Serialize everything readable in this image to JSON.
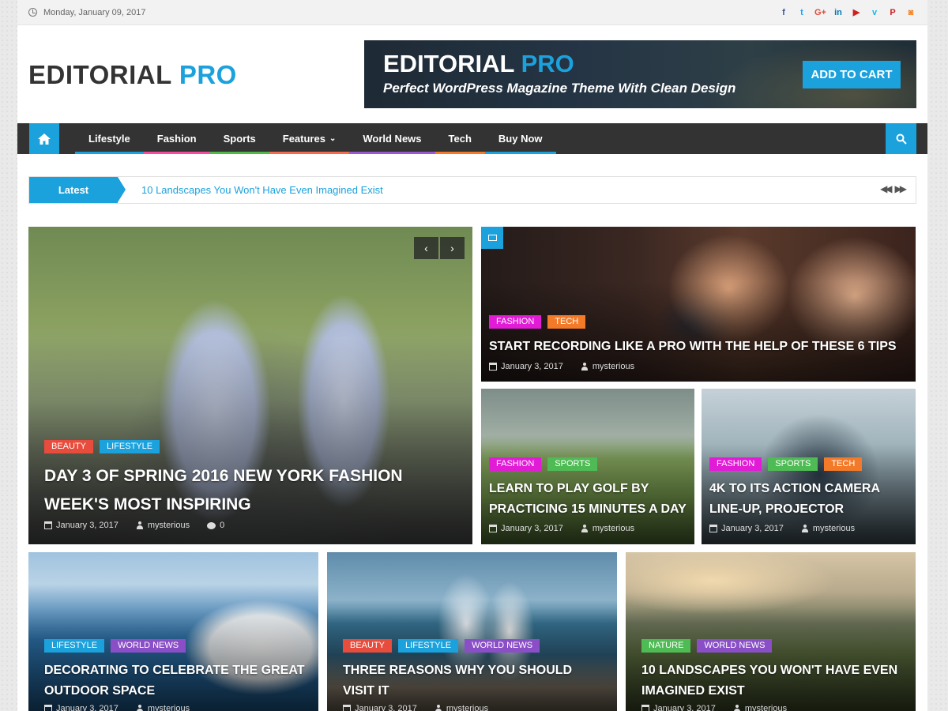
{
  "topbar": {
    "date": "Monday, January 09, 2017",
    "social": [
      {
        "icon": "facebook-icon",
        "glyph": "f",
        "color": "#3b5998"
      },
      {
        "icon": "twitter-icon",
        "glyph": "t",
        "color": "#1da1f2"
      },
      {
        "icon": "google-plus-icon",
        "glyph": "G+",
        "color": "#dd4b39"
      },
      {
        "icon": "linkedin-icon",
        "glyph": "in",
        "color": "#0077b5"
      },
      {
        "icon": "youtube-icon",
        "glyph": "▶",
        "color": "#cd201f"
      },
      {
        "icon": "vimeo-icon",
        "glyph": "v",
        "color": "#1ab7ea"
      },
      {
        "icon": "pinterest-icon",
        "glyph": "P",
        "color": "#cb2027"
      },
      {
        "icon": "instagram-icon",
        "glyph": "◙",
        "color": "#f77f1c"
      }
    ]
  },
  "header": {
    "logo_main": "EDITORIAL",
    "logo_accent": "PRO",
    "banner": {
      "title_main": "EDITORIAL",
      "title_accent": "PRO",
      "subtitle": "Perfect  WordPress Magazine Theme With Clean Design",
      "button": "ADD TO CART"
    }
  },
  "nav": {
    "items": [
      {
        "label": "Lifestyle",
        "color": "#1ba1dc"
      },
      {
        "label": "Fashion",
        "color": "#f04e9c"
      },
      {
        "label": "Sports",
        "color": "#52b848"
      },
      {
        "label": "Features",
        "color": "#f46b4f",
        "chevron": "⌄"
      },
      {
        "label": "World News",
        "color": "#9b59d0"
      },
      {
        "label": "Tech",
        "color": "#f37a28"
      },
      {
        "label": "Buy Now",
        "color": "#1ba1dc"
      }
    ]
  },
  "ticker": {
    "label": "Latest",
    "headline": "10 Landscapes You Won't Have Even Imagined Exist"
  },
  "colors": {
    "accent": "#1ba1dc",
    "beauty": "#e74c3c",
    "lifestyle": "#1ba1dc",
    "fashion": "#e11bd6",
    "tech": "#f37a28",
    "sports": "#4fbb55",
    "world_news": "#8a4fc7",
    "nature": "#4fbb55"
  },
  "posts": {
    "main": {
      "tags": [
        "BEAUTY",
        "LIFESTYLE"
      ],
      "title": "DAY 3 OF SPRING 2016 NEW YORK FASHION WEEK'S MOST INSPIRING",
      "date": "January 3, 2017",
      "author": "mysterious",
      "comments": "0"
    },
    "record": {
      "tags": [
        "FASHION",
        "TECH"
      ],
      "title": "START RECORDING LIKE A PRO WITH THE HELP OF THESE 6 TIPS",
      "date": "January 3, 2017",
      "author": "mysterious"
    },
    "golf": {
      "tags": [
        "FASHION",
        "SPORTS"
      ],
      "title": "LEARN TO PLAY GOLF BY PRACTICING 15 MINUTES A DAY",
      "date": "January 3, 2017",
      "author": "mysterious"
    },
    "camera": {
      "tags": [
        "FASHION",
        "SPORTS",
        "TECH"
      ],
      "title": "4K TO ITS ACTION CAMERA LINE-UP, PROJECTOR",
      "date": "January 3, 2017",
      "author": "mysterious"
    },
    "decorating": {
      "tags": [
        "LIFESTYLE",
        "WORLD NEWS"
      ],
      "title": "DECORATING TO CELEBRATE THE GREAT OUTDOOR SPACE",
      "date": "January 3, 2017",
      "author": "mysterious"
    },
    "reasons": {
      "tags": [
        "BEAUTY",
        "LIFESTYLE",
        "WORLD NEWS"
      ],
      "title": "THREE REASONS WHY YOU SHOULD VISIT IT",
      "date": "January 3, 2017",
      "author": "mysterious"
    },
    "landscapes": {
      "tags": [
        "NATURE",
        "WORLD NEWS"
      ],
      "title": "10 LANDSCAPES YOU WON'T HAVE EVEN IMAGINED EXIST",
      "date": "January 3, 2017",
      "author": "mysterious"
    }
  }
}
